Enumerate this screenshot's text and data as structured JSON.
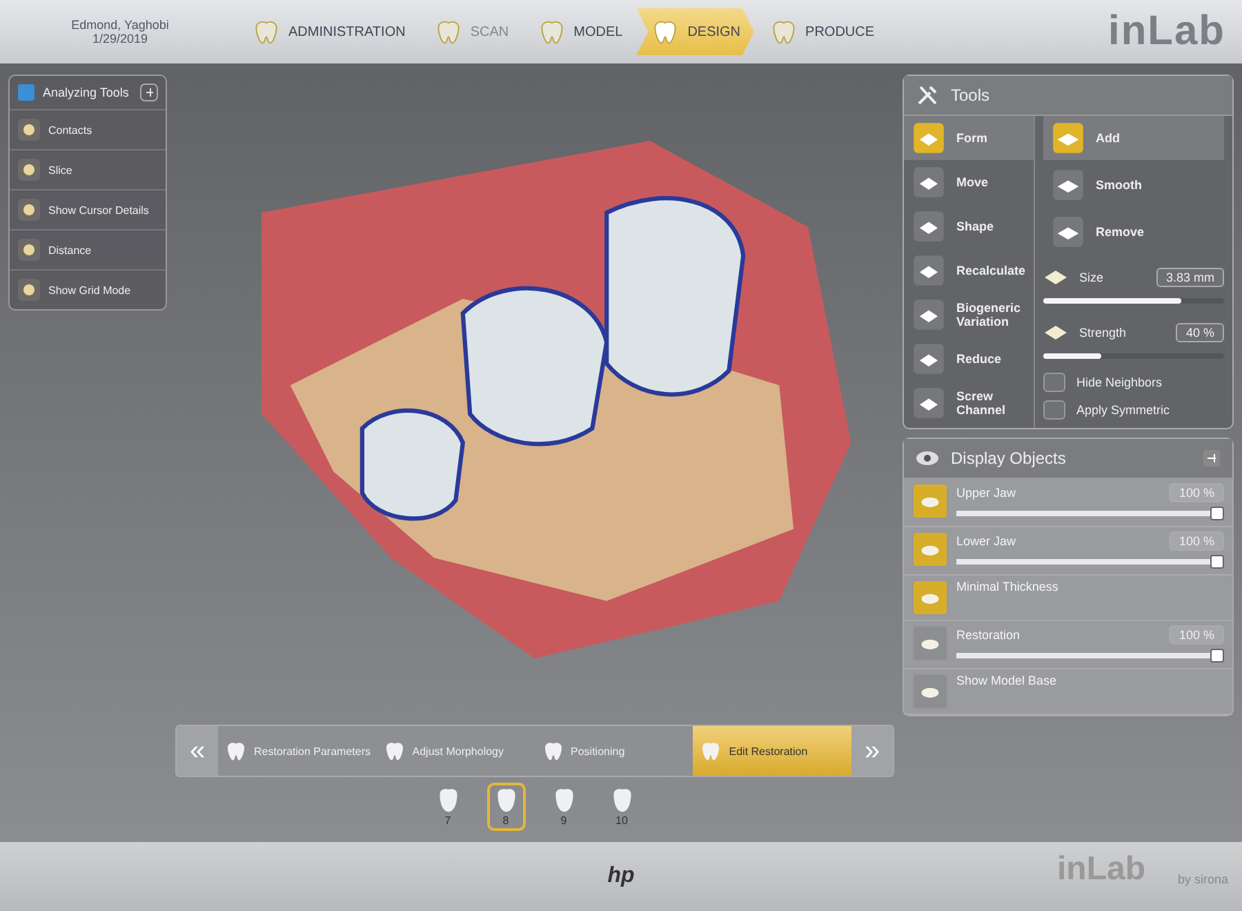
{
  "header": {
    "patient_name": "Edmond, Yaghobi",
    "date": "1/29/2019",
    "logo": "inLab",
    "steps": [
      {
        "label": "ADMINISTRATION",
        "selected": false,
        "disabled": false
      },
      {
        "label": "SCAN",
        "selected": false,
        "disabled": true
      },
      {
        "label": "MODEL",
        "selected": false,
        "disabled": false
      },
      {
        "label": "DESIGN",
        "selected": true,
        "disabled": false
      },
      {
        "label": "PRODUCE",
        "selected": false,
        "disabled": false
      }
    ]
  },
  "analyzing_tools": {
    "title": "Analyzing Tools",
    "items": [
      "Contacts",
      "Slice",
      "Show Cursor Details",
      "Distance",
      "Show Grid Mode"
    ]
  },
  "tools": {
    "title": "Tools",
    "modes": [
      {
        "label": "Form",
        "selected": true
      },
      {
        "label": "Move",
        "selected": false
      },
      {
        "label": "Shape",
        "selected": false
      },
      {
        "label": "Recalculate",
        "selected": false
      },
      {
        "label": "Biogeneric Variation",
        "selected": false
      },
      {
        "label": "Reduce",
        "selected": false
      },
      {
        "label": "Screw Channel",
        "selected": false
      }
    ],
    "actions": [
      {
        "label": "Add",
        "selected": true
      },
      {
        "label": "Smooth",
        "selected": false
      },
      {
        "label": "Remove",
        "selected": false
      }
    ],
    "sliders": [
      {
        "label": "Size",
        "reading": "3.83 mm",
        "level": 0.76
      },
      {
        "label": "Strength",
        "reading": "40 %",
        "level": 0.32
      }
    ],
    "options": [
      {
        "label": "Hide Neighbors",
        "checked": false
      },
      {
        "label": "Apply Symmetric",
        "checked": false
      }
    ]
  },
  "display_objects": {
    "title": "Display Objects",
    "items": [
      {
        "label": "Upper Jaw",
        "visible": true,
        "reading": "100 %",
        "level": 1
      },
      {
        "label": "Lower Jaw",
        "visible": true,
        "reading": "100 %",
        "level": 1
      },
      {
        "label": "Minimal Thickness",
        "visible": true
      },
      {
        "label": "Restoration",
        "visible": false,
        "reading": "100 %",
        "level": 1
      },
      {
        "label": "Show Model Base",
        "visible": false
      }
    ]
  },
  "workflow": {
    "back": "«",
    "forward": "»",
    "steps": [
      {
        "label": "Restoration Parameters",
        "selected": false
      },
      {
        "label": "Adjust Morphology",
        "selected": false
      },
      {
        "label": "Positioning",
        "selected": false
      },
      {
        "label": "Edit Restoration",
        "selected": true
      }
    ],
    "teeth": [
      {
        "label": "7",
        "selected": false
      },
      {
        "label": "8",
        "selected": true
      },
      {
        "label": "9",
        "selected": false
      },
      {
        "label": "10",
        "selected": false
      }
    ]
  },
  "bezel": {
    "brand": "hp",
    "logo": "inLab",
    "logo_sub": "by sirona"
  }
}
